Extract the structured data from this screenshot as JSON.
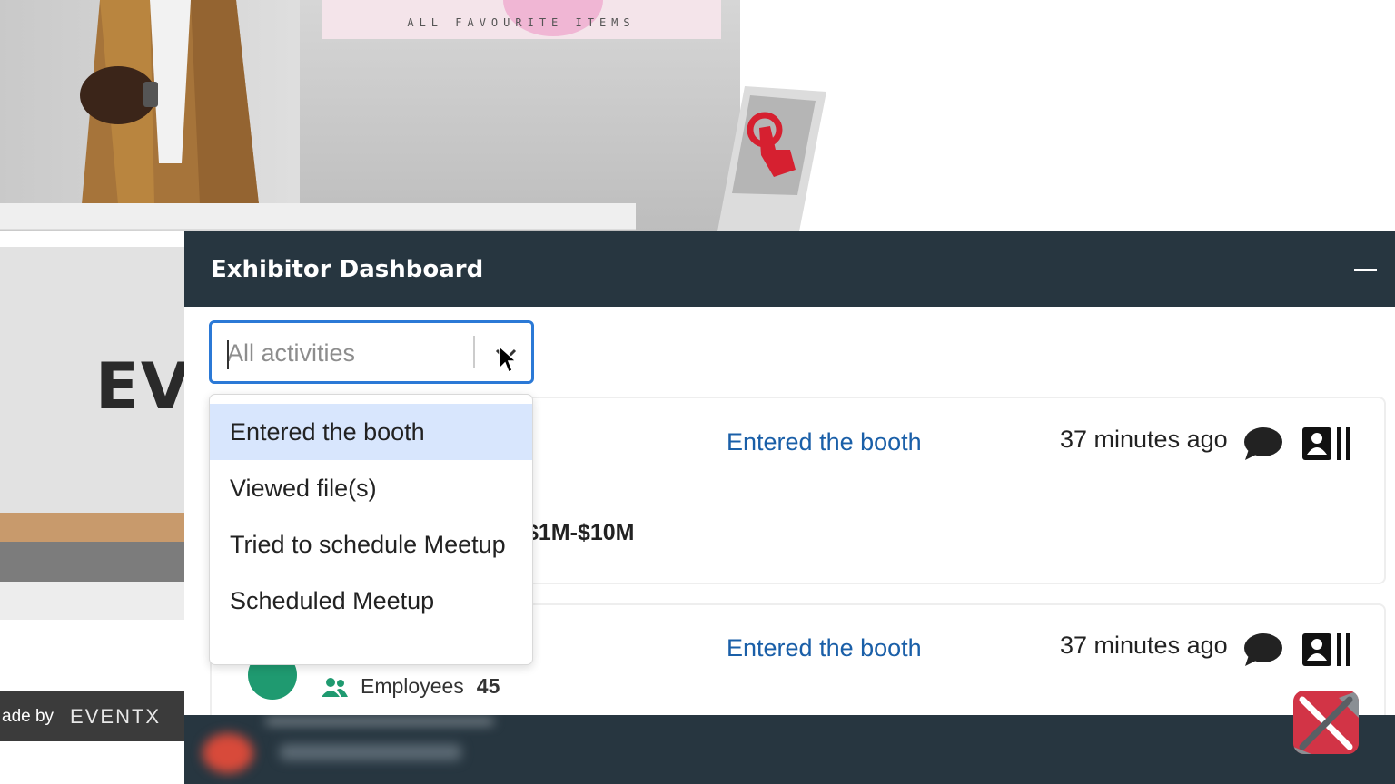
{
  "booth": {
    "banner_text": "ALL FAVOURITE ITEMS",
    "logo_fragment": "EV",
    "made_by_label": "ade by",
    "made_by_logo": "EVENTX"
  },
  "dashboard": {
    "title": "Exhibitor Dashboard",
    "filter": {
      "placeholder": "All activities"
    },
    "dropdown_options": [
      "Entered the booth",
      "Viewed file(s)",
      "Tried to schedule Meetup",
      "Scheduled Meetup"
    ],
    "activities": [
      {
        "action": "Entered the booth",
        "time": "37 minutes ago",
        "revenue_fragment": "$1M-$10M"
      },
      {
        "action": "Entered the booth",
        "time": "37 minutes ago",
        "employees_label": "Employees",
        "employees_count": "45"
      }
    ]
  },
  "colors": {
    "header_bg": "#273640",
    "accent_blue": "#2b79d6",
    "link_blue": "#1a5fa8",
    "highlight": "#d8e6fd",
    "avatar_green": "#1f9a70",
    "fab_red": "#d23446"
  },
  "icons": [
    "minimize-icon",
    "chevron-down-icon",
    "chat-icon",
    "contact-card-icon",
    "employees-icon",
    "touch-icon",
    "pointer-cursor-icon"
  ]
}
